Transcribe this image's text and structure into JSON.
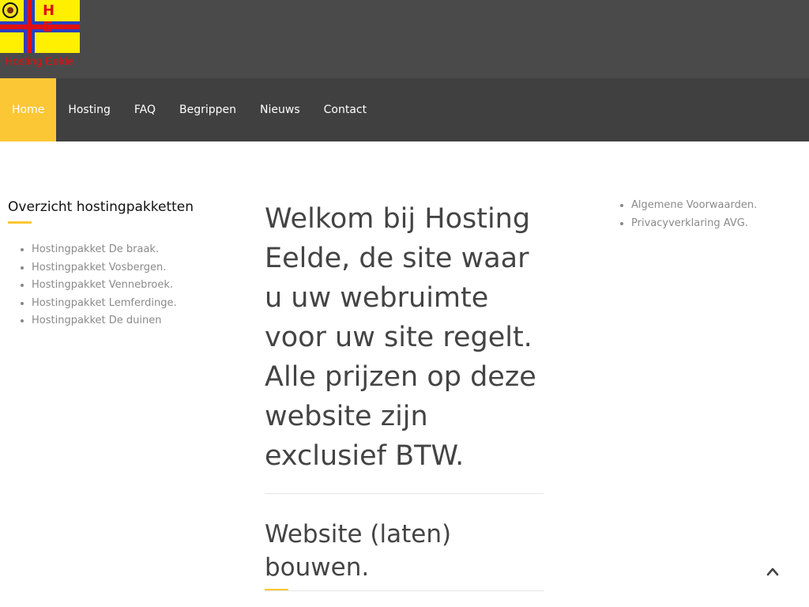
{
  "header": {
    "logo_letters": "H E",
    "site_name": "Hosting Eelde"
  },
  "nav": {
    "items": [
      {
        "label": "Home",
        "active": true
      },
      {
        "label": "Hosting"
      },
      {
        "label": "FAQ"
      },
      {
        "label": "Begrippen"
      },
      {
        "label": "Nieuws"
      },
      {
        "label": "Contact"
      }
    ]
  },
  "sidebar_left": {
    "title": "Overzicht hostingpakketten",
    "items": [
      "Hostingpakket De braak.",
      "Hostingpakket Vosbergen.",
      "Hostingpakket Vennebroek.",
      "Hostingpakket Lemferdinge.",
      "Hostingpakket De duinen"
    ]
  },
  "main": {
    "heading": "Welkom bij Hosting Eelde, de site waar u uw webruimte voor uw site regelt. Alle prijzen op deze website zijn exclusief BTW.",
    "subheading": "Website (laten) bouwen."
  },
  "sidebar_right": {
    "items": [
      "Algemene Voorwaarden.",
      "Privacyverklaring AVG."
    ]
  },
  "colors": {
    "accent": "#fcc735",
    "topbar": "#4a4a4a",
    "navbar": "#404040",
    "site_name": "#e01010"
  },
  "icons": {
    "scroll_top": "chevron-up-icon"
  }
}
